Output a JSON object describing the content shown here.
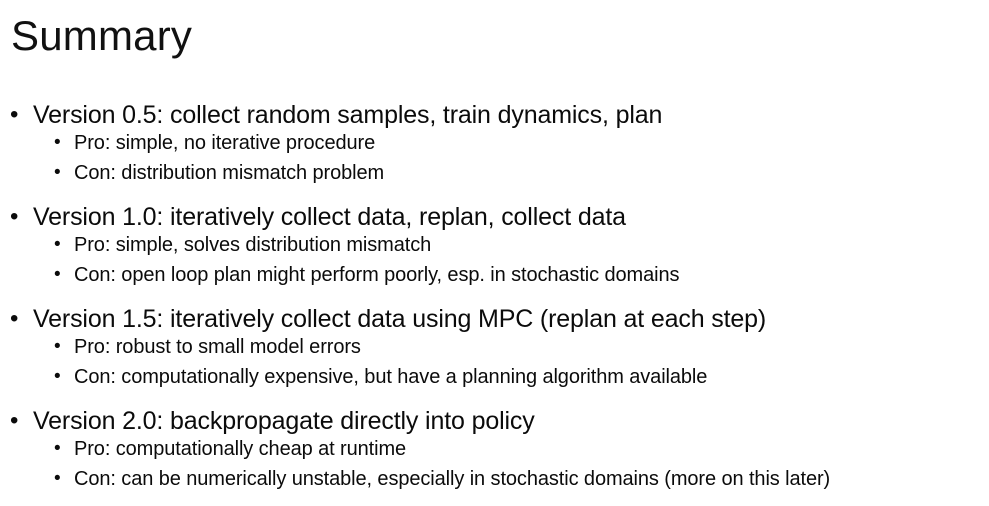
{
  "slide": {
    "title": "Summary",
    "bullet_glyph": "•",
    "items": [
      {
        "text": "Version 0.5: collect random samples, train dynamics, plan",
        "subs": [
          "Pro: simple, no iterative procedure",
          "Con: distribution mismatch problem"
        ]
      },
      {
        "text": "Version 1.0: iteratively collect data, replan, collect data",
        "subs": [
          "Pro: simple, solves distribution mismatch",
          "Con: open loop plan might perform poorly, esp. in stochastic domains"
        ]
      },
      {
        "text": "Version 1.5: iteratively collect data using MPC (replan at each step)",
        "subs": [
          "Pro: robust to small model errors",
          "Con: computationally expensive, but have a planning algorithm available"
        ]
      },
      {
        "text": "Version 2.0: backpropagate directly into policy",
        "subs": [
          "Pro: computationally cheap at runtime",
          "Con: can be numerically unstable, especially in stochastic domains (more on this later)"
        ]
      }
    ]
  }
}
